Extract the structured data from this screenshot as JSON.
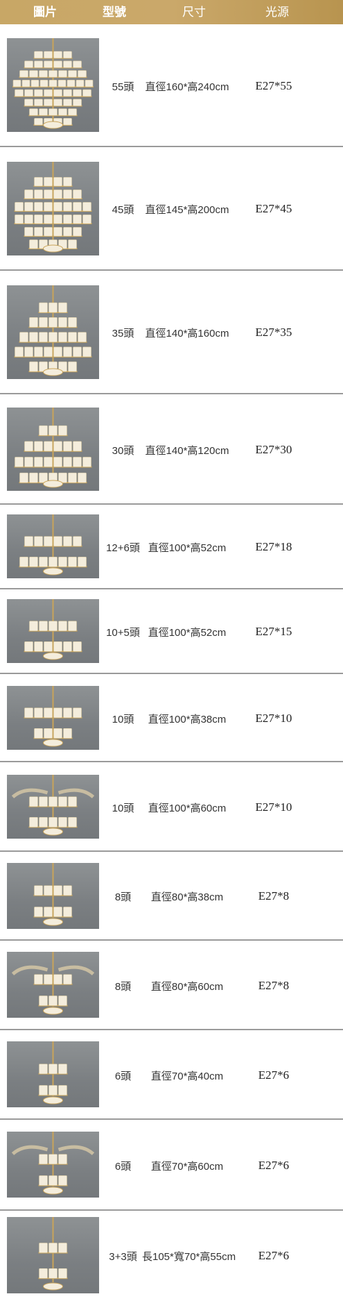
{
  "header": {
    "image": "圖片",
    "model": "型號",
    "size": "尺寸",
    "light": "光源"
  },
  "rows": [
    {
      "model": "55頭",
      "size": "直徑160*高240cm",
      "light": "E27*55"
    },
    {
      "model": "45頭",
      "size": "直徑145*高200cm",
      "light": "E27*45"
    },
    {
      "model": "35頭",
      "size": "直徑140*高160cm",
      "light": "E27*35"
    },
    {
      "model": "30頭",
      "size": "直徑140*高120cm",
      "light": "E27*30"
    },
    {
      "model": "12+6頭",
      "size": "直徑100*高52cm",
      "light": "E27*18"
    },
    {
      "model": "10+5頭",
      "size": "直徑100*高52cm",
      "light": "E27*15"
    },
    {
      "model": "10頭",
      "size": "直徑100*高38cm",
      "light": "E27*10"
    },
    {
      "model": "10頭",
      "size": "直徑100*高60cm",
      "light": "E27*10"
    },
    {
      "model": "8頭",
      "size": "直徑80*高38cm",
      "light": "E27*8"
    },
    {
      "model": "8頭",
      "size": "直徑80*高60cm",
      "light": "E27*8"
    },
    {
      "model": "6頭",
      "size": "直徑70*高40cm",
      "light": "E27*6"
    },
    {
      "model": "6頭",
      "size": "直徑70*高60cm",
      "light": "E27*6"
    },
    {
      "model": "3+3頭",
      "size": "長105*寬70*高55cm",
      "light": "E27*6"
    }
  ],
  "colors": {
    "header": "#c8a766",
    "header_text": "#ffffff",
    "divider": "#9a9a9a",
    "gold": "#c9a45a",
    "shade": "#f4eddc"
  }
}
